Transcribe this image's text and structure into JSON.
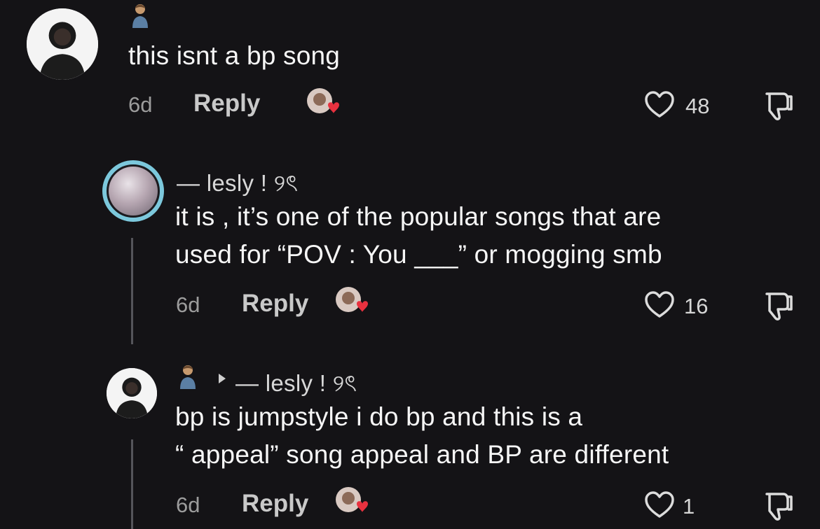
{
  "comments": [
    {
      "emoji": "person-emoji",
      "text": "this isnt a bp song",
      "time": "6d",
      "reply_label": "Reply",
      "likes": "48"
    },
    {
      "username": "— lesly ! ୨ৎ",
      "text_lines": [
        "it is , it’s one of the popular songs that are",
        "used for “POV : You ___” or mogging smb"
      ],
      "time": "6d",
      "reply_label": "Reply",
      "likes": "16"
    },
    {
      "emoji": "person-emoji",
      "reply_to": "— lesly ! ୨ৎ",
      "text_lines": [
        "bp is jumpstyle i do bp and this is a",
        "“ appeal” song appeal and BP are different"
      ],
      "time": "6d",
      "reply_label": "Reply",
      "likes": "1"
    }
  ],
  "colors": {
    "background": "#141316",
    "ring": "#7cc8dc",
    "heart_badge": "#e8313f"
  }
}
